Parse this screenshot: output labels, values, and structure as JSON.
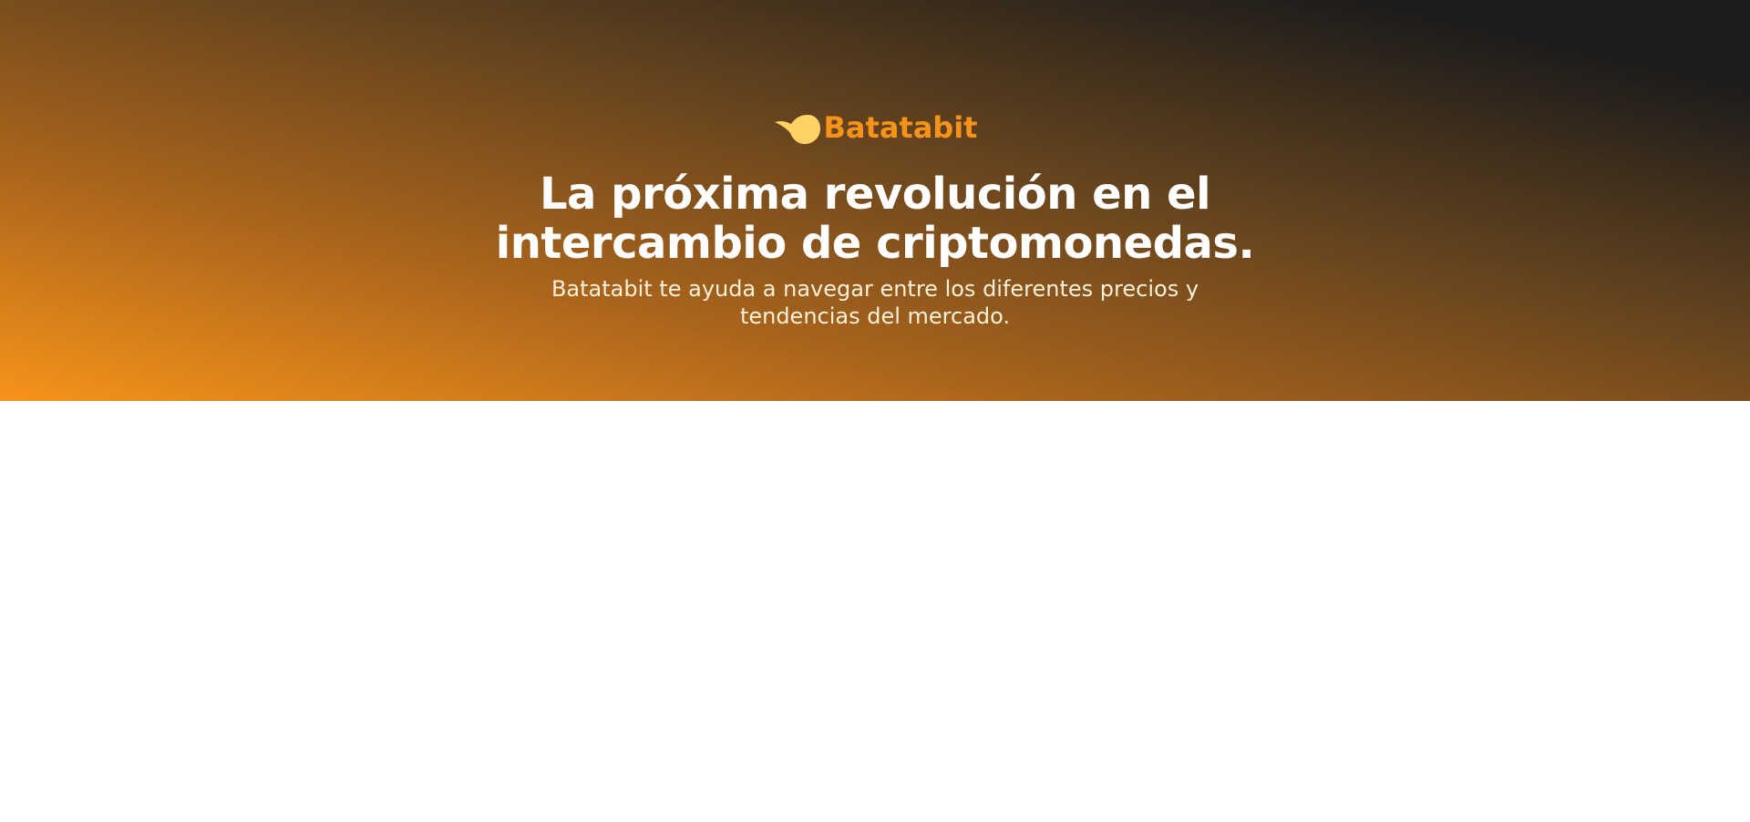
{
  "hero": {
    "logo_icon": "batata-icon",
    "brand_name": "Batatabit",
    "headline_line1": "La próxima revolución en el",
    "headline_line2": "intercambio de criptomonedas.",
    "subline_line1": "Batatabit te ayuda a navegar entre los diferentes precios y",
    "subline_line2": "tendencias del mercado.",
    "colors": {
      "brand": "#f7931a",
      "logo": "#ffd267",
      "headline": "#ffffff",
      "subline": "#faf0d8",
      "gradient_start": "#f7931a",
      "gradient_end": "#1f1d1b",
      "page_background": "#ffffff"
    }
  }
}
